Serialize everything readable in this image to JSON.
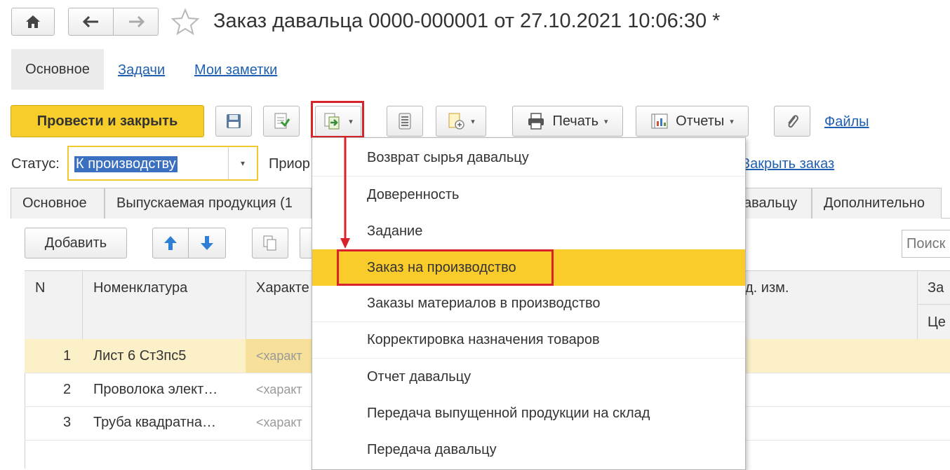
{
  "window": {
    "title": "Заказ давальца 0000-000001 от 27.10.2021 10:06:30 *"
  },
  "sections": {
    "main": "Основное",
    "tasks": "Задачи",
    "notes": "Мои заметки"
  },
  "toolbar": {
    "post_close": "Провести и закрыть",
    "print": "Печать",
    "reports": "Отчеты",
    "files": "Файлы"
  },
  "status": {
    "label": "Статус:",
    "value": "К производству",
    "priority_label": "Приор",
    "close_order": "Закрыть заказ"
  },
  "tabs": [
    "Основное",
    "Выпускаемая продукция (1",
    "авальцу",
    "Дополнительно"
  ],
  "table_toolbar": {
    "add": "Добавить",
    "search_placeholder": "Поиск"
  },
  "table": {
    "headers": {
      "n": "N",
      "nomenclature": "Номенклатура",
      "characteristic": "Характе",
      "unit": "д. изм.",
      "extra": "За",
      "price": "Це"
    },
    "rows": [
      {
        "n": "1",
        "name": "Лист 6 Ст3пс5",
        "char": "<характ"
      },
      {
        "n": "2",
        "name": "Проволока элект…",
        "char": "<характ"
      },
      {
        "n": "3",
        "name": "Труба квадратна…",
        "char": "<характ"
      }
    ]
  },
  "menu": {
    "items": [
      "Возврат сырья давальцу",
      "Доверенность",
      "Задание",
      "Заказ на производство",
      "Заказы материалов в производство",
      "Корректировка назначения товаров",
      "Отчет давальцу",
      "Передача выпущенной продукции на склад",
      "Передача давальцу"
    ],
    "active_index": 3
  },
  "colors": {
    "accent_yellow": "#f9cb2b",
    "highlight_red": "#d9232a",
    "link_blue": "#1f5fb0",
    "row_selected": "#fbf0c8"
  }
}
